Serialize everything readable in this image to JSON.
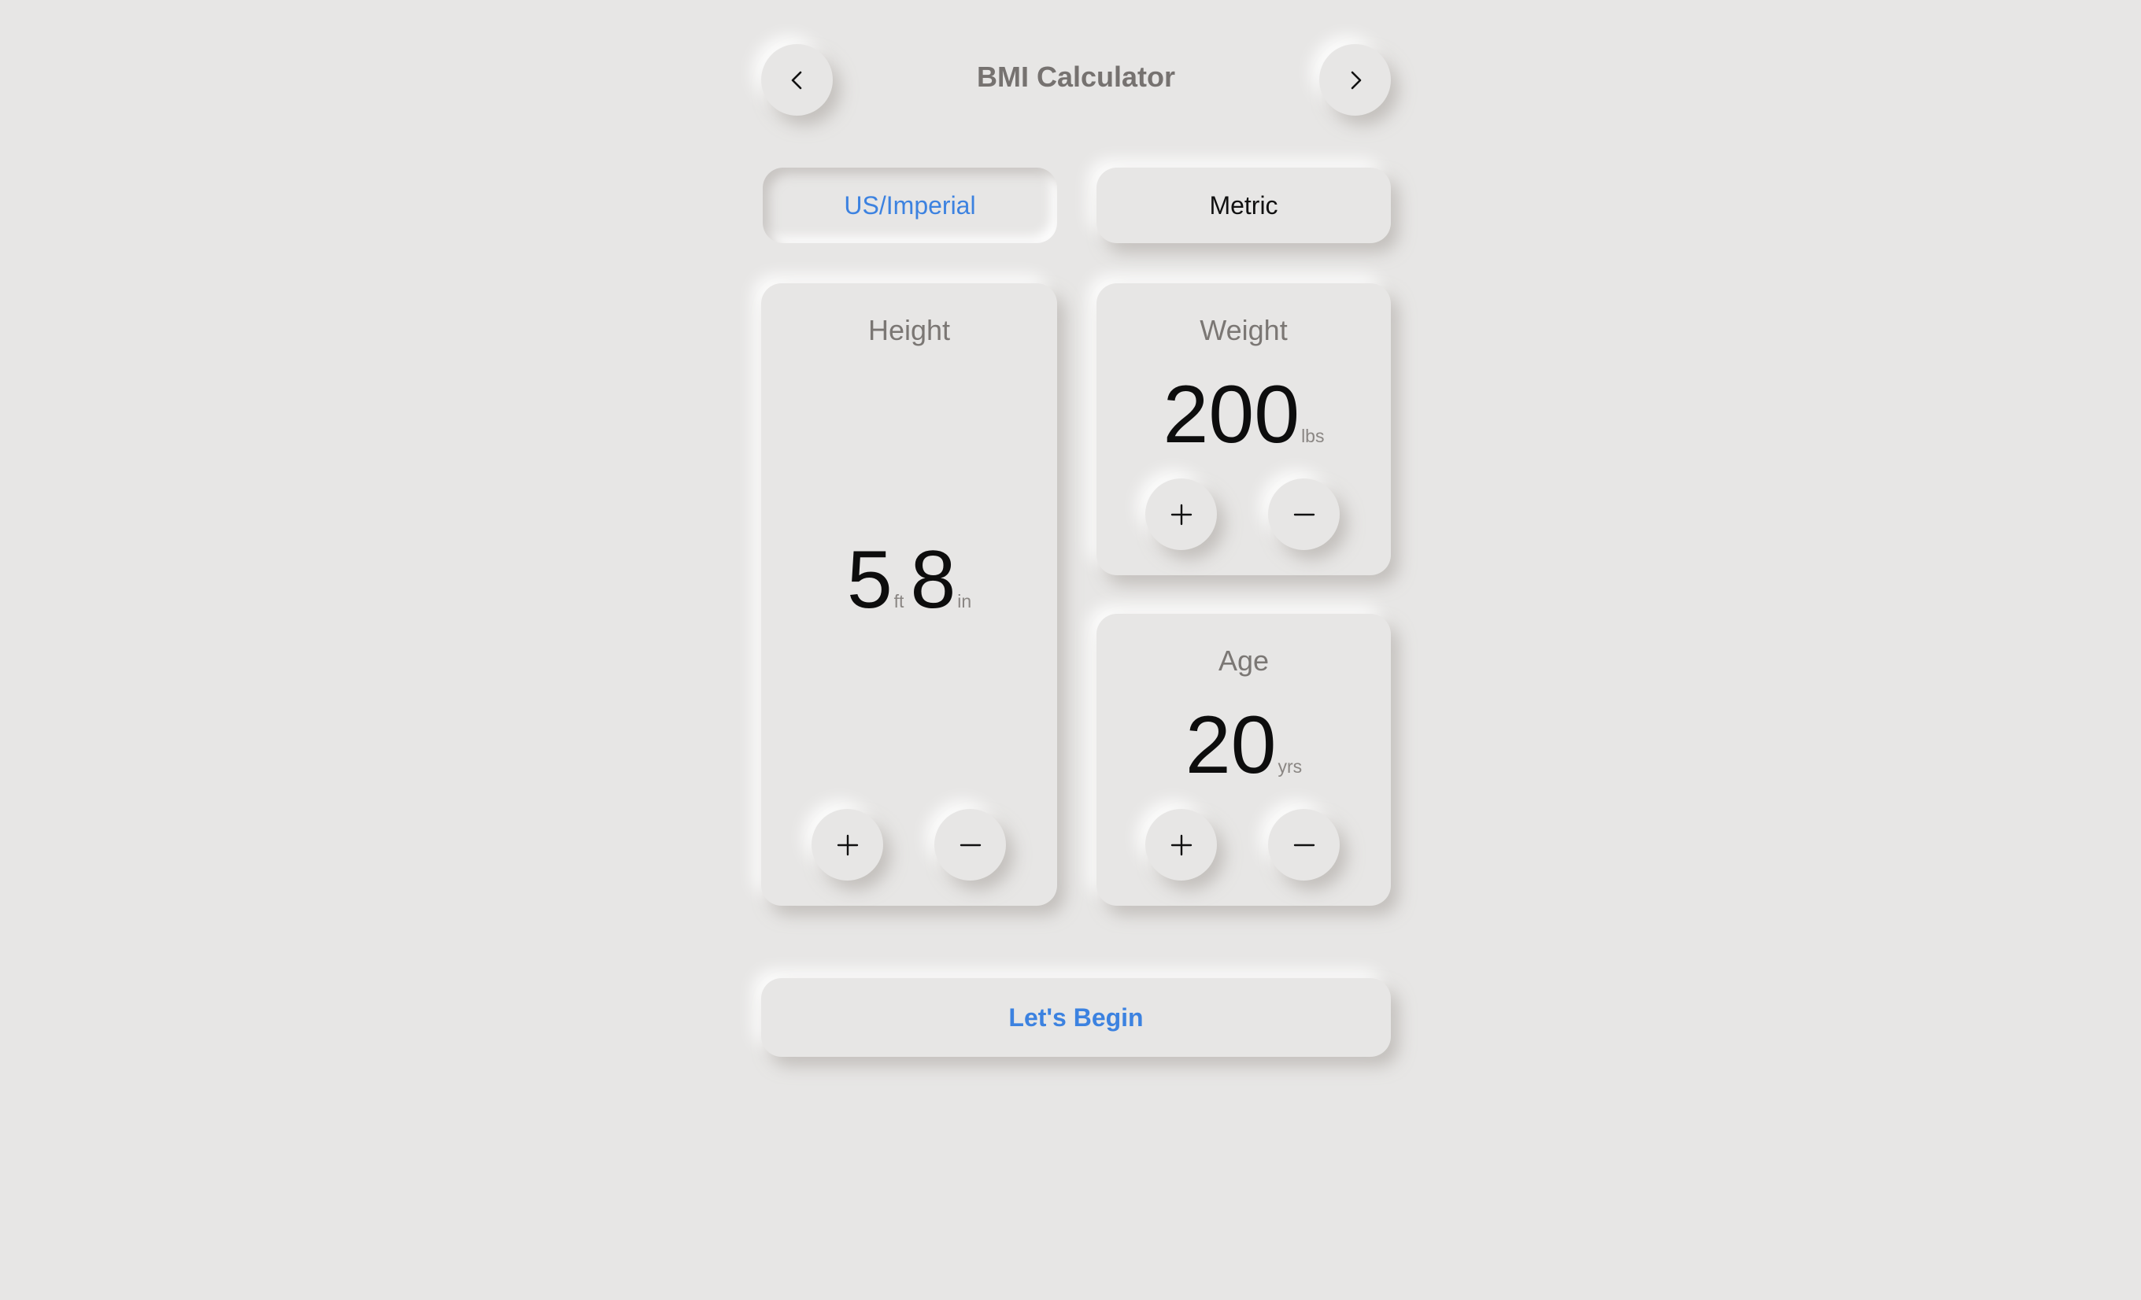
{
  "header": {
    "title": "BMI Calculator",
    "back_icon": "chevron-left-icon",
    "forward_icon": "chevron-right-icon"
  },
  "units": {
    "options": [
      "US/Imperial",
      "Metric"
    ],
    "selected": "US/Imperial"
  },
  "height": {
    "label": "Height",
    "feet": "5",
    "feet_unit": "ft",
    "inches": "8",
    "inches_unit": "in"
  },
  "weight": {
    "label": "Weight",
    "value": "200",
    "unit": "lbs"
  },
  "age": {
    "label": "Age",
    "value": "20",
    "unit": "yrs"
  },
  "actions": {
    "begin_label": "Let's Begin"
  },
  "colors": {
    "background": "#e7e6e5",
    "accent": "#3c82e0",
    "title": "#767270",
    "label": "#7b7774"
  }
}
